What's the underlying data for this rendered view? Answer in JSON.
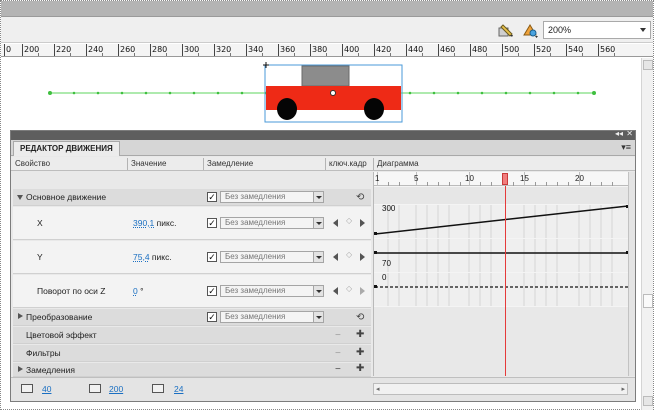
{
  "toolbar": {
    "zoom": "200%"
  },
  "ruler": {
    "labels": [
      "0",
      "200",
      "220",
      "240",
      "260",
      "280",
      "300",
      "320",
      "340",
      "360",
      "380",
      "400",
      "420",
      "440",
      "460",
      "480",
      "500",
      "520",
      "540",
      "560"
    ]
  },
  "panel": {
    "title": "РЕДАКТОР ДВИЖЕНИЯ",
    "columns": {
      "property": "Свойство",
      "value": "Значение",
      "easing": "Замедление",
      "keyframe": "ключ.кадр",
      "graph": "Диаграмма"
    },
    "easing_option": "Без замедления",
    "unit_px": "пикс.",
    "unit_deg": "°",
    "rows": {
      "basic": "Основное движение",
      "x_label": "X",
      "x_value": "390,1",
      "y_label": "Y",
      "y_value": "75,4",
      "rot_label": "Поворот по оси Z",
      "rot_value": "0",
      "transform": "Преобразование",
      "color": "Цветовой эффект",
      "filters": "Фильтры",
      "eases": "Замедления"
    },
    "graph": {
      "scale_labels": [
        "1",
        "5",
        "10",
        "15",
        "20"
      ],
      "x_axis_label": "300",
      "y_axis_label": "70",
      "rot_axis_label": "0"
    },
    "bottom": {
      "v1": "40",
      "v2": "200",
      "v3": "24"
    }
  }
}
